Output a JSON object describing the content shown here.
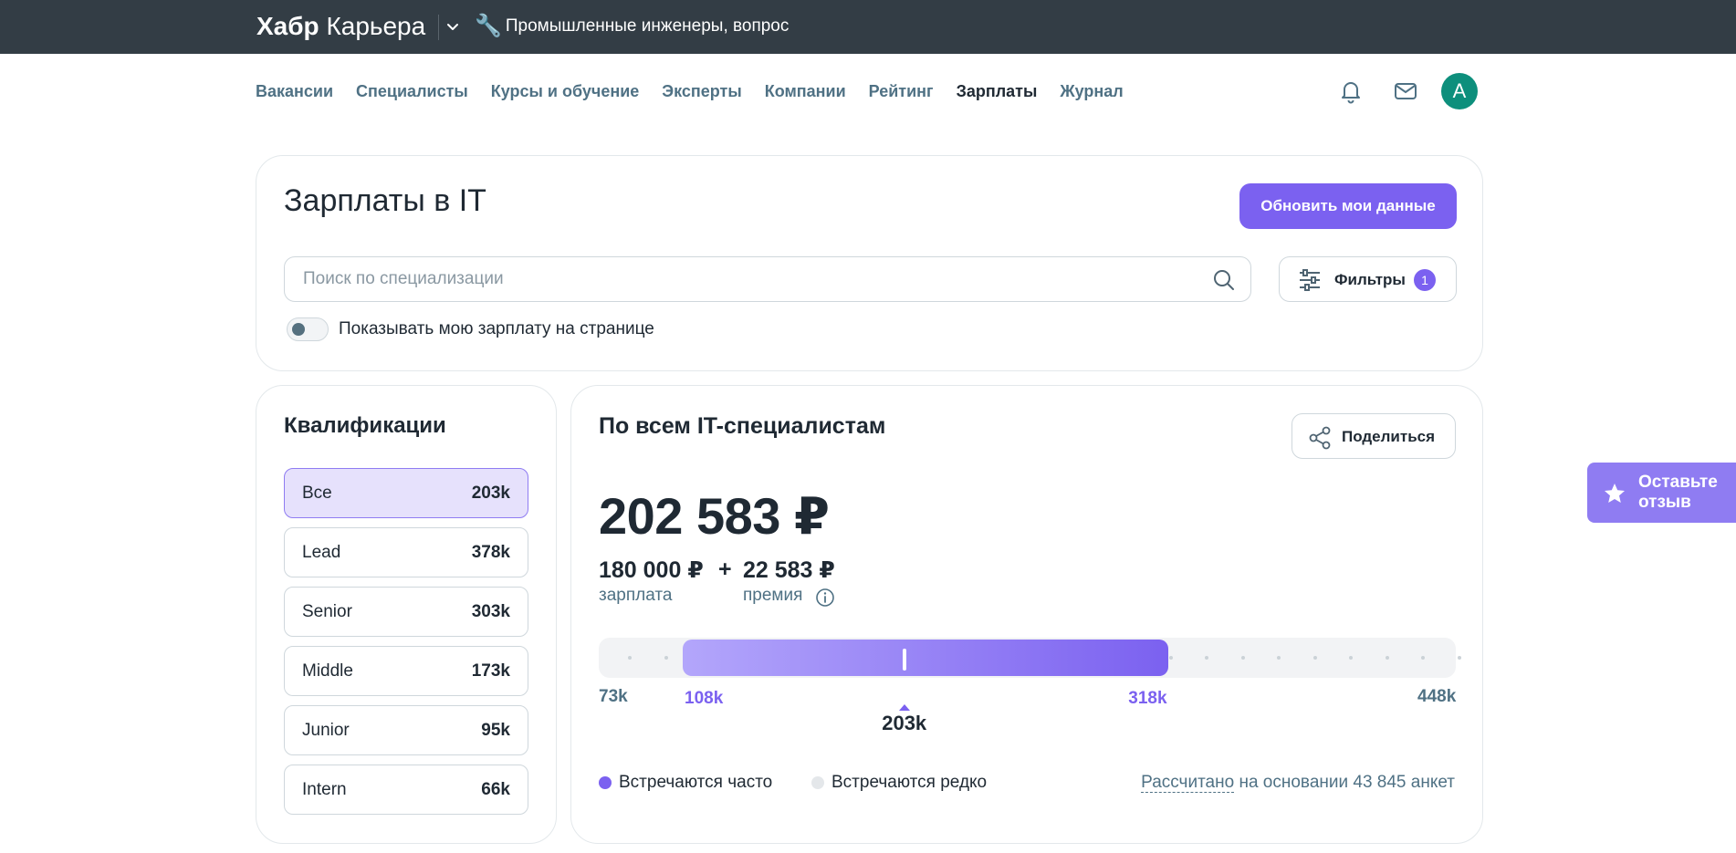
{
  "topbar": {
    "brand_bold": "Хабр",
    "brand_regular": "Карьера",
    "promo_icon": "wrench-icon",
    "promo_text": "Промышленные инженеры, вопрос"
  },
  "nav": {
    "items": [
      "Вакансии",
      "Специалисты",
      "Курсы и обучение",
      "Эксперты",
      "Компании",
      "Рейтинг",
      "Зарплаты",
      "Журнал"
    ],
    "active": "Зарплаты",
    "avatar_letter": "A",
    "avatar_color": "#0d8f7c"
  },
  "header": {
    "title": "Зарплаты в IT",
    "update_button": "Обновить мои данные",
    "search_placeholder": "Поиск по специализации",
    "filters_label": "Фильтры",
    "filters_count": "1",
    "toggle_label": "Показывать мою зарплату на странице",
    "toggle_on": false
  },
  "qualifications": {
    "title": "Квалификации",
    "items": [
      {
        "name": "Все",
        "value": "203k",
        "active": true
      },
      {
        "name": "Lead",
        "value": "378k",
        "active": false
      },
      {
        "name": "Senior",
        "value": "303k",
        "active": false
      },
      {
        "name": "Middle",
        "value": "173k",
        "active": false
      },
      {
        "name": "Junior",
        "value": "95k",
        "active": false
      },
      {
        "name": "Intern",
        "value": "66k",
        "active": false
      }
    ]
  },
  "salary": {
    "title": "По всем IT-специалистам",
    "share_label": "Поделиться",
    "total": "202 583 ₽",
    "base_value": "180 000 ₽",
    "base_label": "зарплата",
    "plus": "+",
    "bonus_value": "22 583 ₽",
    "bonus_label": "премия",
    "range": {
      "min": 73,
      "max": 448,
      "low": 108,
      "high": 318,
      "median": 203,
      "min_label": "73k",
      "max_label": "448k",
      "low_label": "108k",
      "high_label": "318k",
      "median_label": "203k"
    },
    "legend": [
      {
        "label": "Встречаются часто",
        "color": "#7b61f0"
      },
      {
        "label": "Встречаются редко",
        "color": "#e4e7ea"
      }
    ],
    "basis_link": "Рассчитано",
    "basis_rest": "на основании 43 845 анкет"
  },
  "feedback": {
    "label": "Оставьте отзыв",
    "icon": "star-icon"
  },
  "colors": {
    "accent": "#7b61f0",
    "topbar": "#333d45",
    "nav_link": "#4f7184"
  }
}
